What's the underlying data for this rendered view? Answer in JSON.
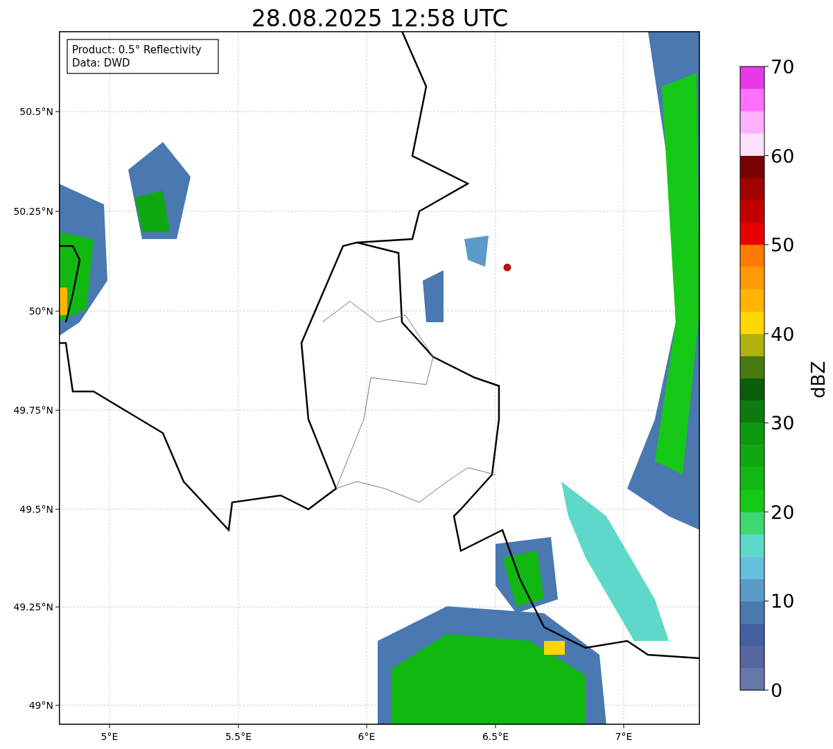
{
  "title": "28.08.2025 12:58 UTC",
  "info_box": [
    "Product: 0.5° Reflectivity",
    "Data: DWD"
  ],
  "map": {
    "x_ticks": [
      "5°E",
      "5.5°E",
      "6°E",
      "6.5°E",
      "7°E"
    ],
    "y_ticks": [
      "50.5°N",
      "50.25°N",
      "50°N",
      "49.75°N",
      "49.5°N",
      "49.25°N",
      "49°N"
    ]
  },
  "colorbar": {
    "label": "dBZ",
    "ticks": [
      "70",
      "60",
      "50",
      "40",
      "30",
      "20",
      "10",
      "0"
    ],
    "bins": [
      {
        "color": "#6677aa"
      },
      {
        "color": "#5566a0"
      },
      {
        "color": "#4460a0"
      },
      {
        "color": "#4a78b0"
      },
      {
        "color": "#5a9ac8"
      },
      {
        "color": "#66c0dc"
      },
      {
        "color": "#5ed8c8"
      },
      {
        "color": "#3ed870"
      },
      {
        "color": "#16c816"
      },
      {
        "color": "#12b812"
      },
      {
        "color": "#10a810"
      },
      {
        "color": "#0e980e"
      },
      {
        "color": "#0c7a0c"
      },
      {
        "color": "#0a5e0a"
      },
      {
        "color": "#467a10"
      },
      {
        "color": "#b0b010"
      },
      {
        "color": "#ffd700"
      },
      {
        "color": "#ffb400"
      },
      {
        "color": "#ff9a00"
      },
      {
        "color": "#ff7c00"
      },
      {
        "color": "#e80000"
      },
      {
        "color": "#c00000"
      },
      {
        "color": "#a00000"
      },
      {
        "color": "#780000"
      },
      {
        "color": "#ffe0ff"
      },
      {
        "color": "#ffb0ff"
      },
      {
        "color": "#ff70ff"
      },
      {
        "color": "#e838e8"
      }
    ]
  }
}
